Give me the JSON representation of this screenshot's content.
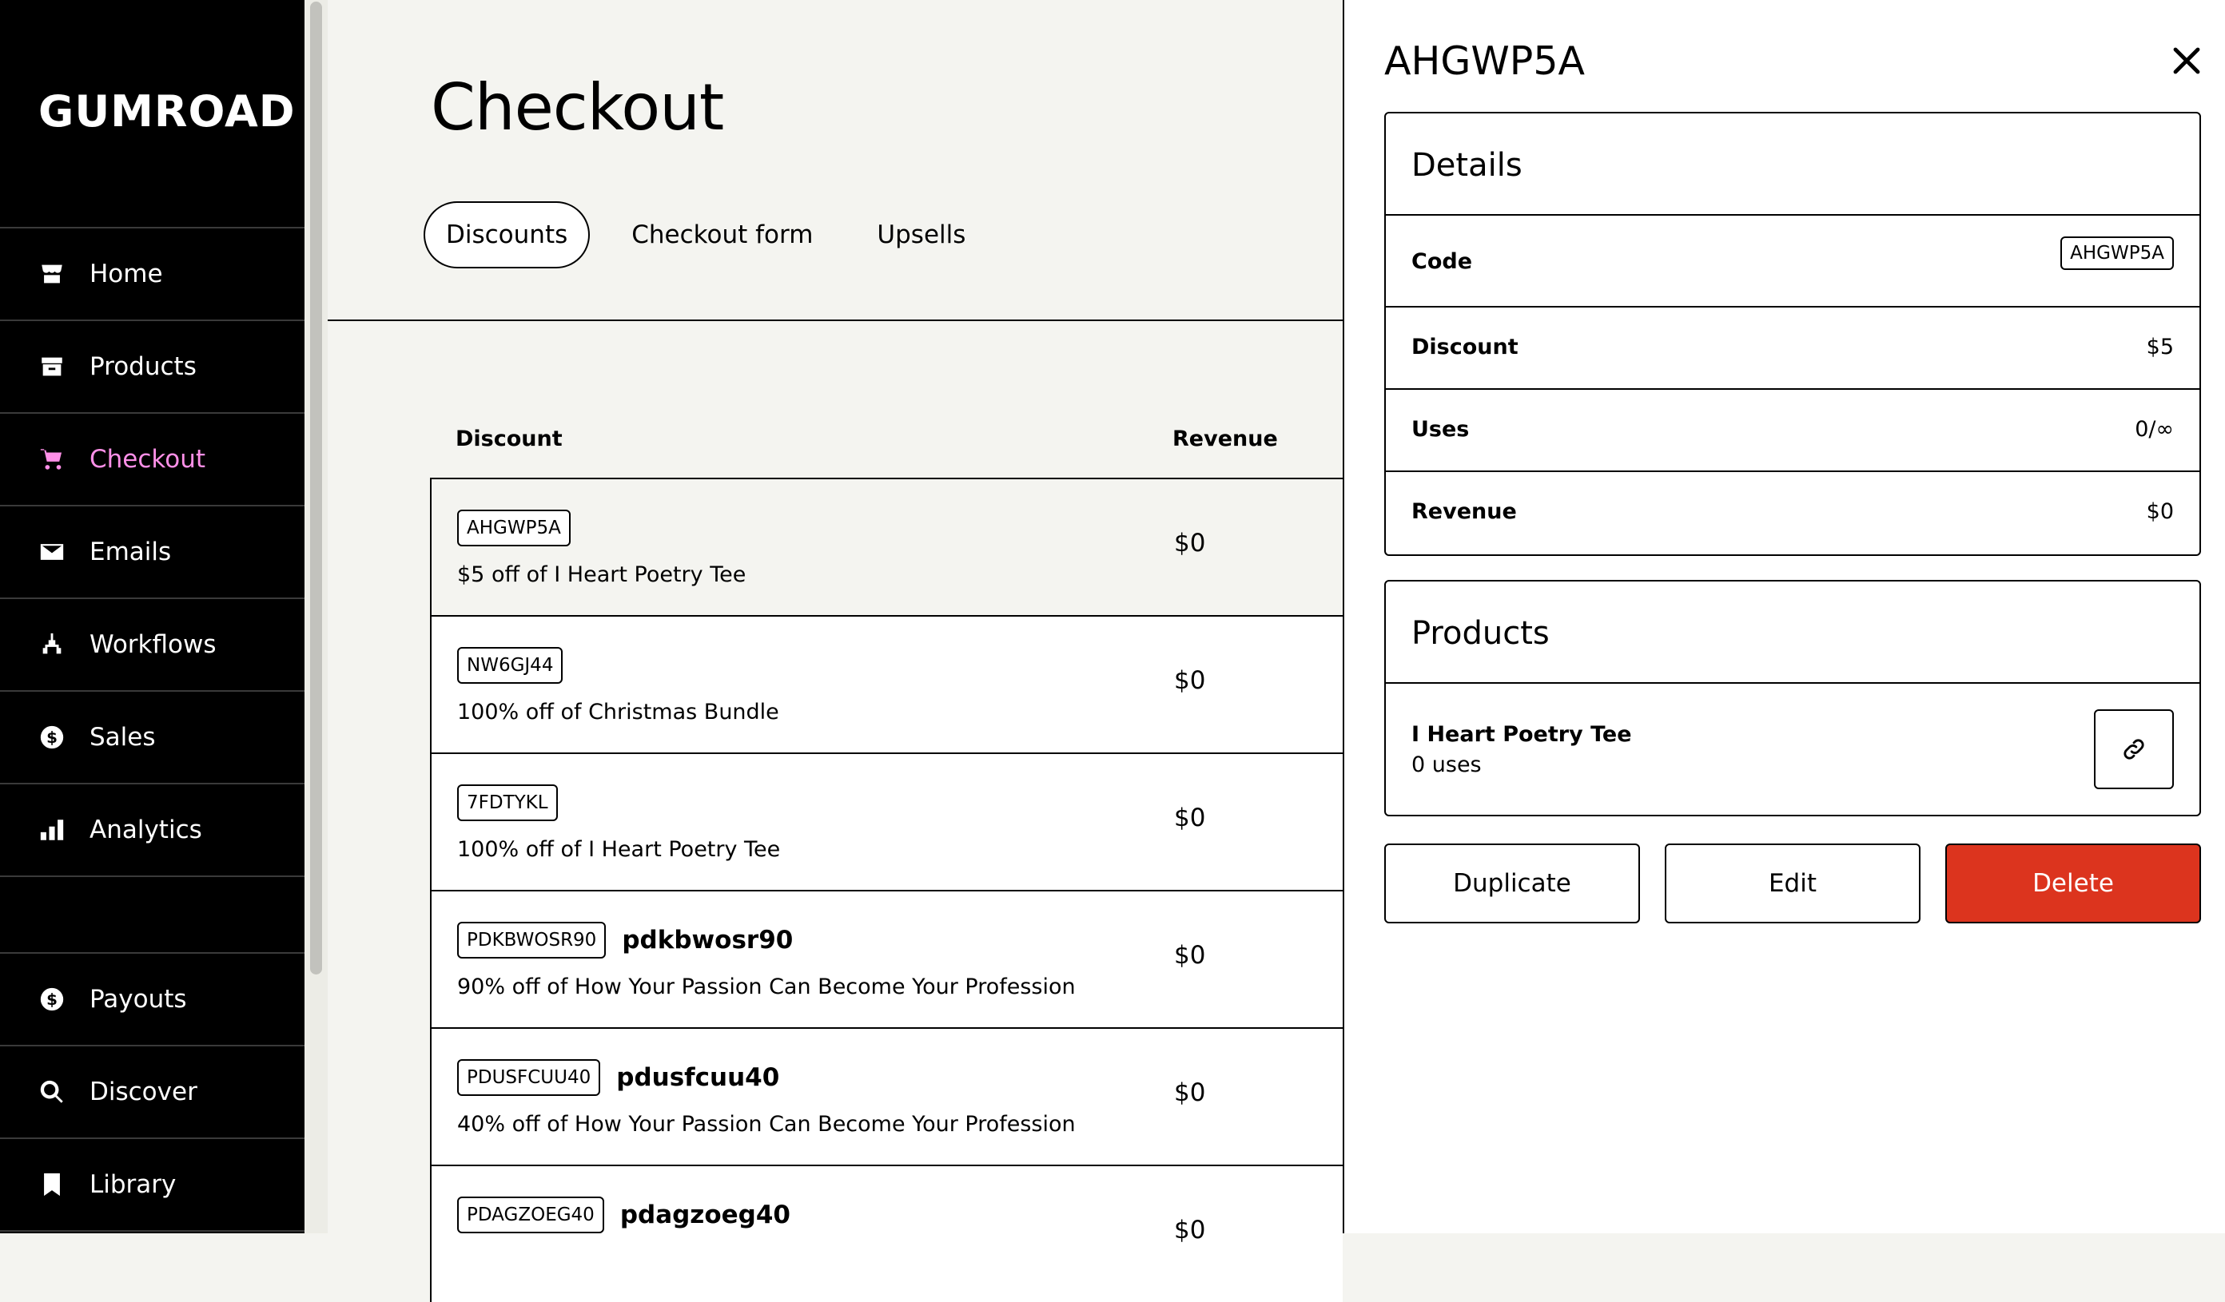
{
  "app": {
    "logo": "GUMROAD"
  },
  "sidebar": {
    "items": [
      {
        "label": "Home",
        "icon": "store-icon"
      },
      {
        "label": "Products",
        "icon": "archive-icon"
      },
      {
        "label": "Checkout",
        "icon": "cart-icon",
        "active": true
      },
      {
        "label": "Emails",
        "icon": "envelope-icon"
      },
      {
        "label": "Workflows",
        "icon": "workflow-icon"
      },
      {
        "label": "Sales",
        "icon": "dollar-circle-icon"
      },
      {
        "label": "Analytics",
        "icon": "bar-chart-icon"
      },
      {
        "label": "Payouts",
        "icon": "dollar-circle-icon"
      },
      {
        "label": "Discover",
        "icon": "search-icon"
      },
      {
        "label": "Library",
        "icon": "bookmark-icon"
      }
    ]
  },
  "main": {
    "title": "Checkout",
    "tabs": [
      {
        "label": "Discounts",
        "active": true
      },
      {
        "label": "Checkout form"
      },
      {
        "label": "Upsells"
      }
    ],
    "table": {
      "headers": {
        "discount": "Discount",
        "revenue": "Revenue"
      },
      "rows": [
        {
          "code": "AHGWP5A",
          "name": "",
          "description": "$5 off of I Heart Poetry Tee",
          "revenue": "$0",
          "selected": true
        },
        {
          "code": "NW6GJ44",
          "name": "",
          "description": "100% off of Christmas Bundle",
          "revenue": "$0"
        },
        {
          "code": "7FDTYKL",
          "name": "",
          "description": "100% off of I Heart Poetry Tee",
          "revenue": "$0"
        },
        {
          "code": "PDKBWOSR90",
          "name": "pdkbwosr90",
          "description": "90% off of How Your Passion Can Become Your Profession",
          "revenue": "$0"
        },
        {
          "code": "PDUSFCUU40",
          "name": "pdusfcuu40",
          "description": "40% off of How Your Passion Can Become Your Profession",
          "revenue": "$0"
        },
        {
          "code": "PDAGZOEG40",
          "name": "pdagzoeg40",
          "description": "",
          "revenue": "$0"
        }
      ]
    }
  },
  "drawer": {
    "title": "AHGWP5A",
    "details": {
      "heading": "Details",
      "code_label": "Code",
      "code_value": "AHGWP5A",
      "discount_label": "Discount",
      "discount_value": "$5",
      "uses_label": "Uses",
      "uses_value": "0/∞",
      "revenue_label": "Revenue",
      "revenue_value": "$0"
    },
    "products": {
      "heading": "Products",
      "items": [
        {
          "name": "I Heart Poetry Tee",
          "uses": "0 uses"
        }
      ]
    },
    "actions": {
      "duplicate": "Duplicate",
      "edit": "Edit",
      "delete": "Delete"
    }
  },
  "colors": {
    "accent": "#ff90e8",
    "danger": "#dc341e",
    "background": "#f4f4f0"
  }
}
